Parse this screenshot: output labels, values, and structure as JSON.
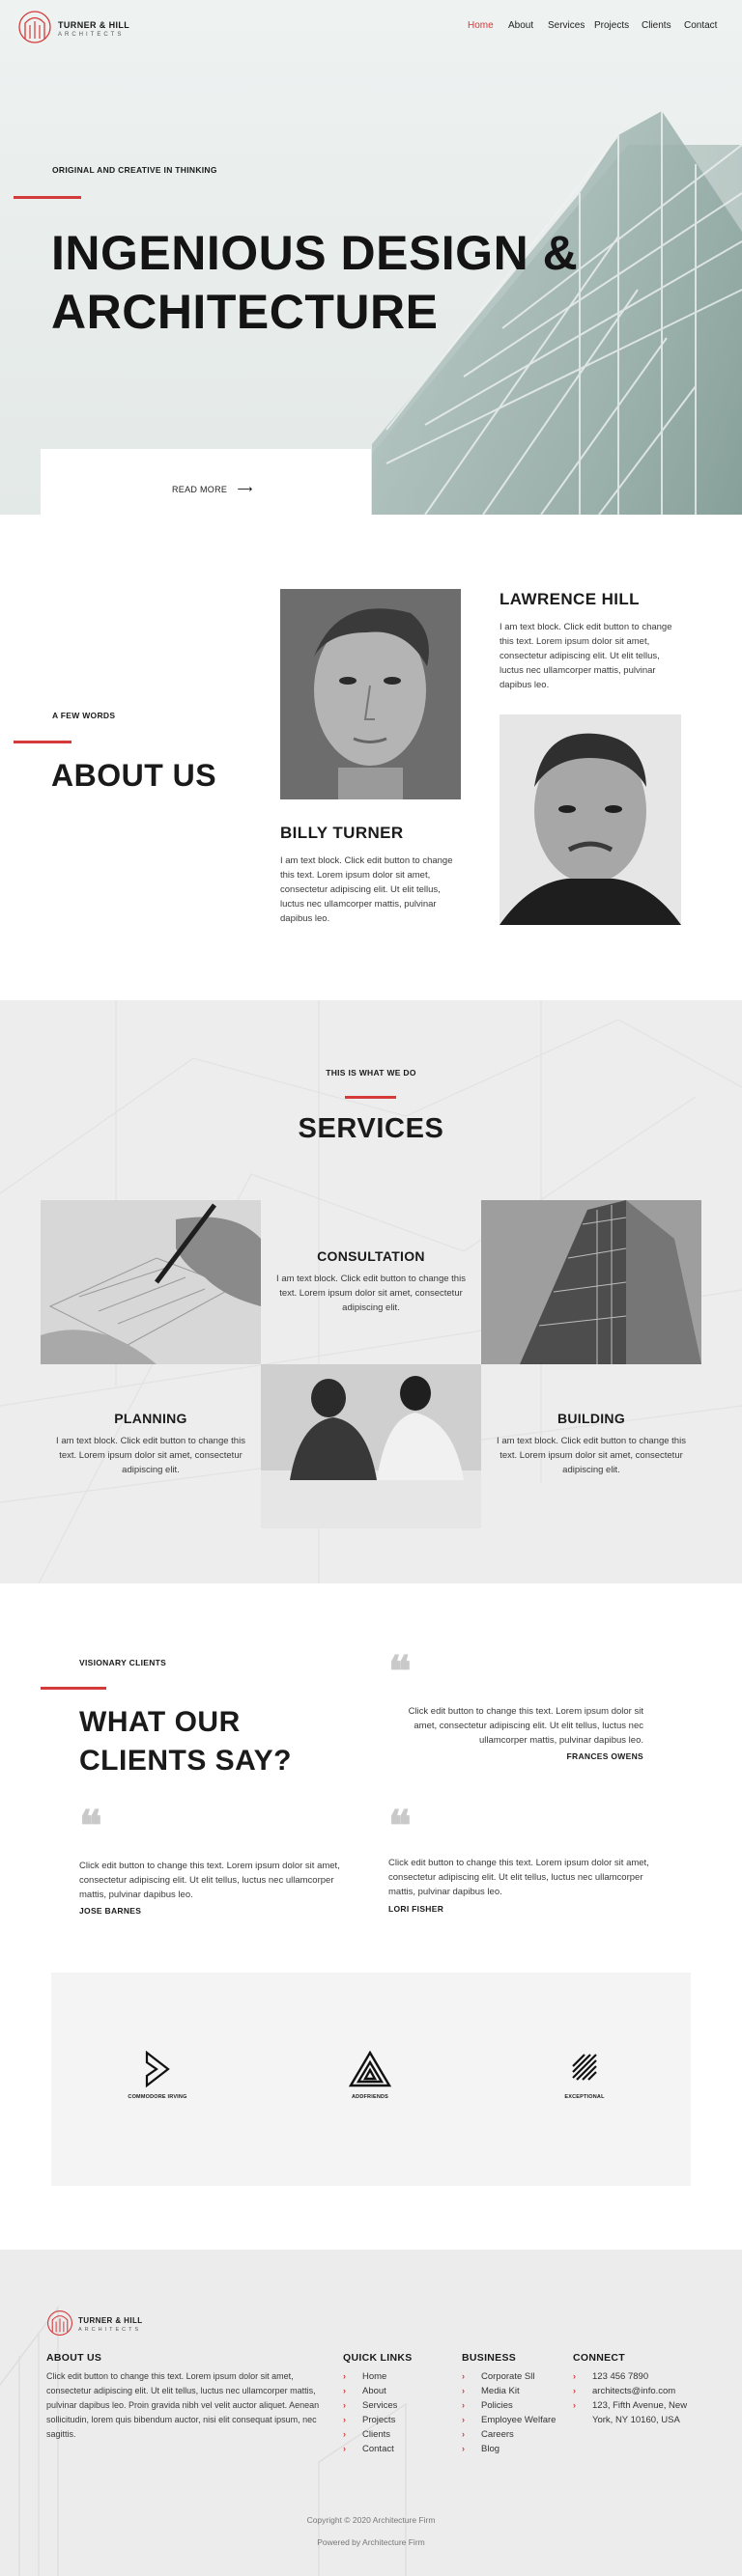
{
  "header": {
    "logo_name": "TURNER & HILL",
    "logo_sub": "ARCHITECTS",
    "nav": [
      "Home",
      "About",
      "Services",
      "Projects",
      "Clients",
      "Contact"
    ],
    "active_nav": "Home",
    "accent_color": "#d43a3a"
  },
  "hero": {
    "eyebrow": "ORIGINAL AND CREATIVE IN THINKING",
    "title_line1": "INGENIOUS DESIGN &",
    "title_line2": "ARCHITECTURE",
    "cta": "READ MORE",
    "cta_icon": "arrow-right-icon"
  },
  "about": {
    "eyebrow": "A FEW WORDS",
    "title": "ABOUT US",
    "members": [
      {
        "name": "LAWRENCE HILL",
        "text": "I am text block. Click edit button to change this text. Lorem ipsum dolor sit amet, consectetur adipiscing elit. Ut elit tellus, luctus nec ullamcorper mattis, pulvinar dapibus leo."
      },
      {
        "name": "BILLY TURNER",
        "text": "I am text block. Click edit button to change this text. Lorem ipsum dolor sit amet, consectetur adipiscing elit. Ut elit tellus, luctus nec ullamcorper mattis, pulvinar dapibus leo."
      }
    ]
  },
  "services": {
    "eyebrow": "THIS IS WHAT WE DO",
    "title": "SERVICES",
    "items": [
      {
        "title": "CONSULTATION",
        "text": "I am text block. Click edit button to change this text. Lorem ipsum dolor sit amet, consectetur adipiscing elit."
      },
      {
        "title": "PLANNING",
        "text": "I am text block. Click edit button to change this text. Lorem ipsum dolor sit amet, consectetur adipiscing elit."
      },
      {
        "title": "BUILDING",
        "text": "I am text block. Click edit button to change this text. Lorem ipsum dolor sit amet, consectetur adipiscing elit."
      }
    ]
  },
  "testimonials": {
    "eyebrow": "VISIONARY CLIENTS",
    "title_line1": "WHAT OUR",
    "title_line2": "CLIENTS SAY?",
    "items": [
      {
        "text": "Click edit button to change this text. Lorem ipsum dolor sit amet, consectetur adipiscing elit. Ut elit tellus, luctus nec ullamcorper mattis, pulvinar dapibus leo.",
        "author": "FRANCES OWENS"
      },
      {
        "text": "Click edit button to change this text. Lorem ipsum dolor sit amet, consectetur adipiscing elit. Ut elit tellus, luctus nec ullamcorper mattis, pulvinar dapibus leo.",
        "author": "JOSE BARNES"
      },
      {
        "text": "Click edit button to change this text. Lorem ipsum dolor sit amet, consectetur adipiscing elit. Ut elit tellus, luctus nec ullamcorper mattis, pulvinar dapibus leo.",
        "author": "LORI FISHER"
      }
    ]
  },
  "partners": [
    "COMMODORE IRVING",
    "ADDFRIENDS",
    "EXCEPTIONAL"
  ],
  "footer": {
    "logo_name": "TURNER & HILL",
    "logo_sub": "ARCHITECTS",
    "about_title": "ABOUT US",
    "about_text": "Click edit button to change this text. Lorem ipsum dolor sit amet, consectetur adipiscing elit. Ut elit tellus, luctus nec ullamcorper mattis, pulvinar dapibus leo. Proin gravida nibh vel velit auctor aliquet. Aenean sollicitudin, lorem quis bibendum auctor, nisi elit consequat ipsum, nec sagittis.",
    "quick_title": "QUICK LINKS",
    "quick_links": [
      "Home",
      "About",
      "Services",
      "Projects",
      "Clients",
      "Contact"
    ],
    "business_title": "BUSINESS",
    "business_links": [
      "Corporate Sll",
      "Media Kit",
      "Policies",
      "Employee Welfare",
      "Careers",
      "Blog"
    ],
    "connect_title": "CONNECT",
    "phone": "123 456 7890",
    "email": "architects@info.com",
    "address_line1": "123, Fifth Avenue, New",
    "address_line2": "York, NY 10160, USA",
    "copyright": "Copyright © 2020 Architecture Firm",
    "powered": "Powered by Architecture Firm"
  }
}
